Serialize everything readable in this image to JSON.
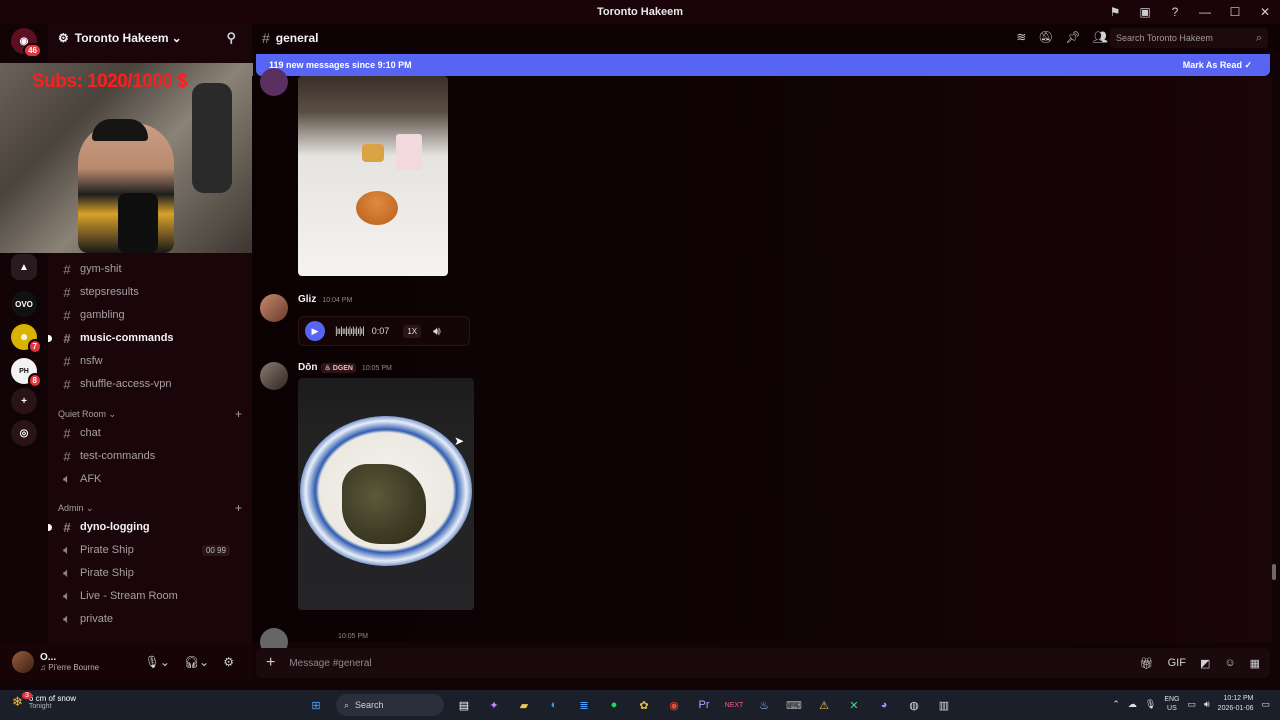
{
  "window": {
    "title": "Toronto Hakeem",
    "controls": [
      "—",
      "☐",
      "✕"
    ],
    "top_icons": [
      "flag-icon",
      "inbox-icon",
      "help-icon"
    ]
  },
  "server": {
    "name": "Toronto Hakeem",
    "dropdown": "⌄"
  },
  "server_rail": [
    {
      "name": "discord-home",
      "badge": "46"
    },
    {
      "name": "server-1",
      "badge": ""
    },
    {
      "name": "ovo-server",
      "badge": ""
    },
    {
      "name": "simpsons-server",
      "badge": "7"
    },
    {
      "name": "phantasmic-server",
      "badge": "8"
    },
    {
      "name": "add-server",
      "badge": ""
    },
    {
      "name": "discover",
      "badge": ""
    }
  ],
  "stream_overlay": {
    "subs_text": "Subs: 1020/1000  $"
  },
  "channels": [
    {
      "name": "gym-shit",
      "type": "text",
      "unread": false
    },
    {
      "name": "stepsresults",
      "type": "text",
      "unread": false
    },
    {
      "name": "gambling",
      "type": "text",
      "unread": false
    },
    {
      "name": "music-commands",
      "type": "text",
      "unread": true
    },
    {
      "name": "nsfw",
      "type": "text",
      "unread": false
    },
    {
      "name": "shuffle-access-vpn",
      "type": "text",
      "unread": false
    }
  ],
  "categories": [
    {
      "name": "Quiet Room",
      "channels": [
        {
          "name": "chat",
          "type": "text",
          "unread": false
        },
        {
          "name": "test-commands",
          "type": "text",
          "unread": false
        },
        {
          "name": "AFK",
          "type": "voice",
          "unread": false
        }
      ]
    },
    {
      "name": "Admin",
      "channels": [
        {
          "name": "dyno-logging",
          "type": "text",
          "unread": true
        },
        {
          "name": "Pirate Ship",
          "type": "voice",
          "unread": false,
          "pills": [
            "00",
            "99"
          ]
        },
        {
          "name": "Pirate Ship",
          "type": "voice",
          "unread": false
        },
        {
          "name": "Live - Stream Room",
          "type": "voice",
          "unread": false
        },
        {
          "name": "private",
          "type": "voice",
          "unread": false
        }
      ]
    }
  ],
  "user": {
    "name": "O...",
    "status": "♫ Pi'erre Bourne"
  },
  "channel_header": {
    "hash": "#",
    "name": "general",
    "search_placeholder": "Search Toronto Hakeem"
  },
  "banner": {
    "text": "119 new messages since 9:10 PM",
    "action": "Mark As Read"
  },
  "messages": [
    {
      "author": "Gliz",
      "time": "10:04 PM",
      "audio": {
        "duration": "0:07",
        "speed": "1X"
      }
    },
    {
      "author": "Dōn",
      "role": "DGEN",
      "time": "10:05 PM"
    },
    {
      "author": "",
      "time": "10:05 PM"
    }
  ],
  "composer": {
    "placeholder": "Message #general"
  },
  "taskbar": {
    "weather_temp": "6 cm of snow",
    "weather_sub": "Tonight",
    "weather_badge": "3",
    "search": "Search",
    "lang": "ENG",
    "region": "US",
    "time": "10:12 PM",
    "date": "2026-01-06"
  },
  "colors": {
    "accent": "#5865f2",
    "bg": "#120306",
    "sidebar": "#1a060a"
  }
}
